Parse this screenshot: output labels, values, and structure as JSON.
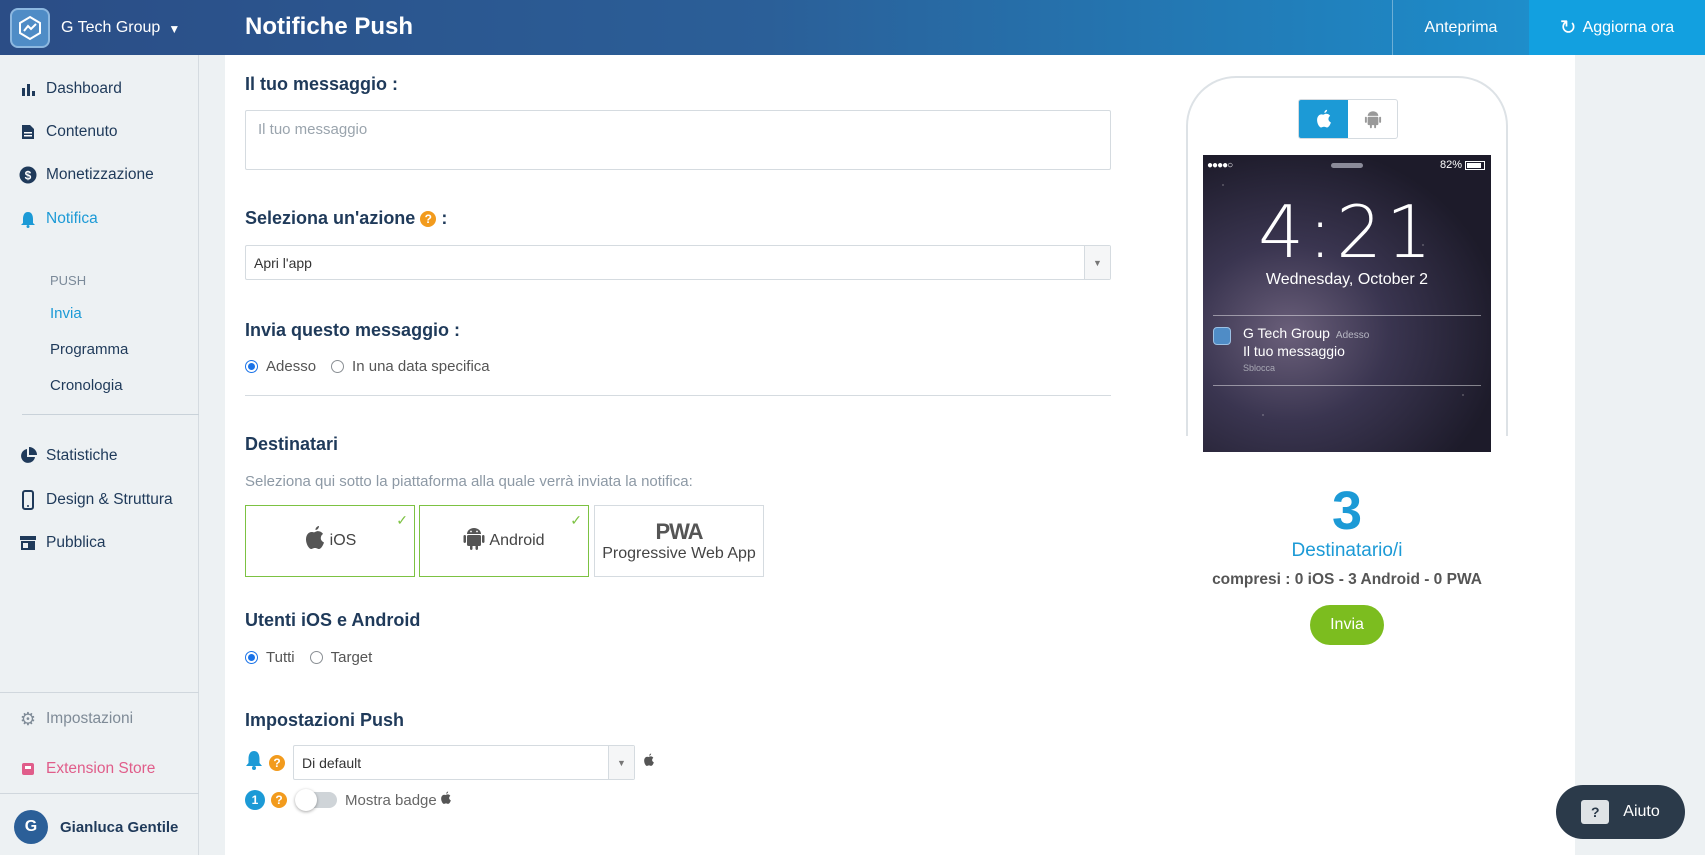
{
  "header": {
    "brand": "G Tech Group",
    "title": "Notifiche Push",
    "preview_label": "Anteprima",
    "update_label": "Aggiorna ora"
  },
  "sidebar": {
    "items": [
      {
        "label": "Dashboard",
        "icon": "bar-chart-icon"
      },
      {
        "label": "Contenuto",
        "icon": "document-icon"
      },
      {
        "label": "Monetizzazione",
        "icon": "dollar-icon"
      },
      {
        "label": "Notifica",
        "icon": "bell-icon"
      },
      {
        "label": "Statistiche",
        "icon": "pie-chart-icon"
      },
      {
        "label": "Design & Struttura",
        "icon": "phone-icon"
      },
      {
        "label": "Pubblica",
        "icon": "store-icon"
      }
    ],
    "sub_heading": "PUSH",
    "sub_items": [
      "Invia",
      "Programma",
      "Cronologia"
    ],
    "settings_label": "Impostazioni",
    "extension_label": "Extension Store",
    "user_name": "Gianluca Gentile",
    "user_initial": "G"
  },
  "form": {
    "message_label": "Il tuo messaggio :",
    "message_placeholder": "Il tuo messaggio",
    "action_label": "Seleziona un'azione",
    "action_colon": ":",
    "action_value": "Apri l'app",
    "send_when_label": "Invia questo messaggio :",
    "send_now": "Adesso",
    "send_date": "In una data specifica",
    "recipients_label": "Destinatari",
    "recipients_hint": "Seleziona qui sotto la piattaforma alla quale verrà inviata la notifica:",
    "platform_ios": "iOS",
    "platform_android": "Android",
    "pwa_logo": "PWA",
    "platform_pwa": "Progressive Web App",
    "users_label": "Utenti iOS e Android",
    "users_all": "Tutti",
    "users_target": "Target",
    "push_settings_label": "Impostazioni Push",
    "sound_value": "Di default",
    "badge_number": "1",
    "badge_label": "Mostra badge"
  },
  "preview": {
    "battery": "82%",
    "time": "4:21",
    "date": "Wednesday, October 2",
    "notif_app": "G Tech Group",
    "notif_time": "Adesso",
    "notif_message": "Il tuo messaggio",
    "notif_sub": "Sblocca"
  },
  "summary": {
    "count": "3",
    "count_label": "Destinatario/i",
    "detail": "compresi : 0 iOS - 3 Android - 0 PWA",
    "send_label": "Invia"
  },
  "help": {
    "label": "Aiuto"
  },
  "colors": {
    "accent": "#1c9ad6",
    "send": "#7cbd1f",
    "help_badge": "#f29b1d",
    "selected_border": "#7cc242"
  }
}
